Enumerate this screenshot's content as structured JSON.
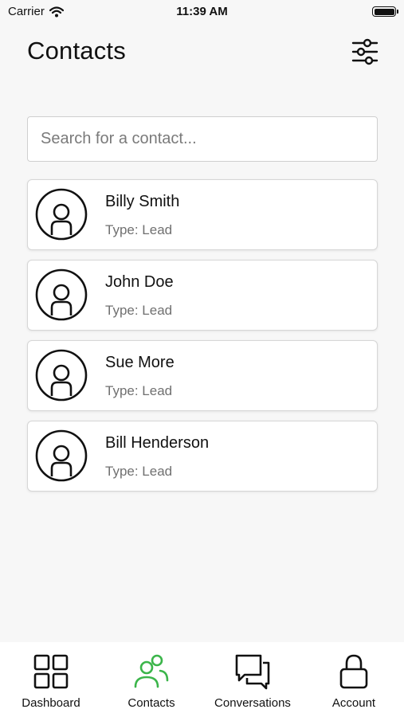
{
  "status_bar": {
    "carrier": "Carrier",
    "time": "11:39 AM"
  },
  "header": {
    "title": "Contacts",
    "filter_icon": "sliders-icon"
  },
  "search": {
    "placeholder": "Search for a contact...",
    "value": ""
  },
  "contacts": [
    {
      "name": "Billy Smith",
      "type": "Type: Lead",
      "icon": "user-avatar-icon"
    },
    {
      "name": "John Doe",
      "type": "Type: Lead",
      "icon": "user-avatar-icon"
    },
    {
      "name": "Sue More",
      "type": "Type: Lead",
      "icon": "user-avatar-icon"
    },
    {
      "name": "Bill Henderson",
      "type": "Type: Lead",
      "icon": "user-avatar-icon"
    }
  ],
  "tabs": [
    {
      "label": "Dashboard",
      "icon": "grid-icon",
      "active": false
    },
    {
      "label": "Contacts",
      "icon": "users-icon",
      "active": true
    },
    {
      "label": "Conversations",
      "icon": "chat-bubbles-icon",
      "active": false
    },
    {
      "label": "Account",
      "icon": "lock-icon",
      "active": false
    }
  ],
  "colors": {
    "accent": "#3bb54a",
    "text": "#111111",
    "muted": "#707070",
    "background": "#f7f7f7"
  }
}
